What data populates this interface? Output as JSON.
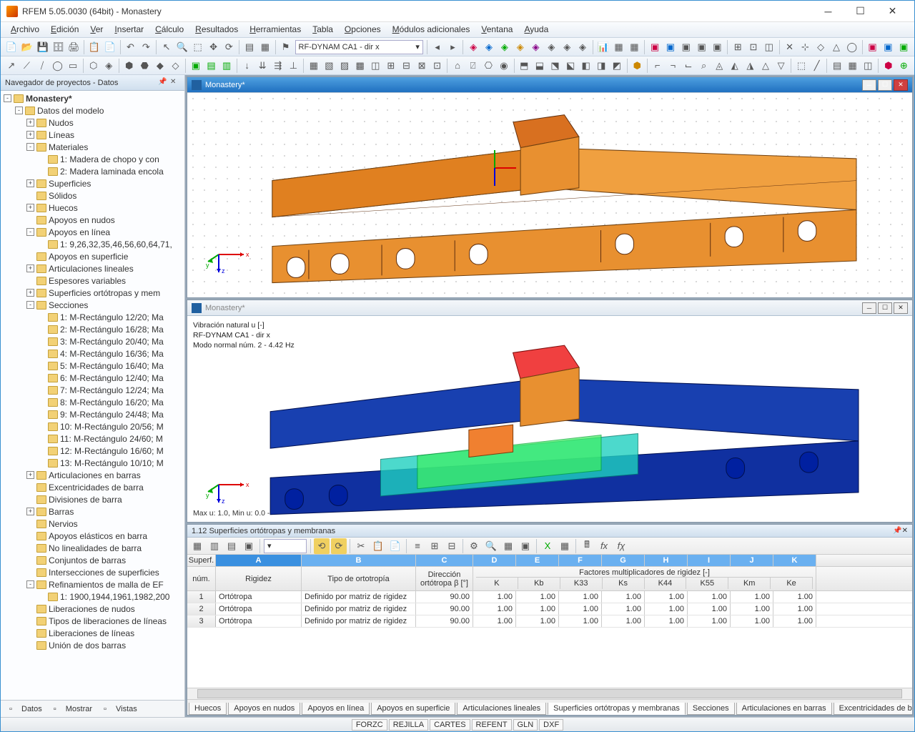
{
  "title": "RFEM 5.05.0030 (64bit) - Monastery",
  "menu": [
    "Archivo",
    "Edición",
    "Ver",
    "Insertar",
    "Cálculo",
    "Resultados",
    "Herramientas",
    "Tabla",
    "Opciones",
    "Módulos adicionales",
    "Ventana",
    "Ayuda"
  ],
  "combo": "RF-DYNAM CA1 - dir x",
  "nav_title": "Navegador de proyectos - Datos",
  "tree": {
    "root": "Monastery*",
    "folder": "Datos del modelo",
    "items": [
      {
        "t": "Nudos",
        "e": "+",
        "i": 1
      },
      {
        "t": "Líneas",
        "e": "+",
        "i": 1
      },
      {
        "t": "Materiales",
        "e": "-",
        "i": 1,
        "c": [
          {
            "t": "1: Madera de chopo y con",
            "i": 2
          },
          {
            "t": "2: Madera laminada encola",
            "i": 2
          }
        ]
      },
      {
        "t": "Superficies",
        "e": "+",
        "i": 1
      },
      {
        "t": "Sólidos",
        "e": "",
        "i": 1
      },
      {
        "t": "Huecos",
        "e": "+",
        "i": 1
      },
      {
        "t": "Apoyos en nudos",
        "e": "",
        "i": 1
      },
      {
        "t": "Apoyos en línea",
        "e": "-",
        "i": 1,
        "c": [
          {
            "t": "1: 9,26,32,35,46,56,60,64,71,",
            "i": 2
          }
        ]
      },
      {
        "t": "Apoyos en superficie",
        "e": "",
        "i": 1
      },
      {
        "t": "Articulaciones lineales",
        "e": "+",
        "i": 1
      },
      {
        "t": "Espesores variables",
        "e": "",
        "i": 1
      },
      {
        "t": "Superficies ortótropas y mem",
        "e": "+",
        "i": 1
      },
      {
        "t": "Secciones",
        "e": "-",
        "i": 1,
        "c": [
          {
            "t": "1: M-Rectángulo 12/20; Ma",
            "i": 2
          },
          {
            "t": "2: M-Rectángulo 16/28; Ma",
            "i": 2
          },
          {
            "t": "3: M-Rectángulo 20/40; Ma",
            "i": 2
          },
          {
            "t": "4: M-Rectángulo 16/36; Ma",
            "i": 2
          },
          {
            "t": "5: M-Rectángulo 16/40; Ma",
            "i": 2
          },
          {
            "t": "6: M-Rectángulo 12/40; Ma",
            "i": 2
          },
          {
            "t": "7: M-Rectángulo 12/24; Ma",
            "i": 2
          },
          {
            "t": "8: M-Rectángulo 16/20; Ma",
            "i": 2
          },
          {
            "t": "9: M-Rectángulo 24/48; Ma",
            "i": 2
          },
          {
            "t": "10: M-Rectángulo 20/56; M",
            "i": 2
          },
          {
            "t": "11: M-Rectángulo 24/60; M",
            "i": 2
          },
          {
            "t": "12: M-Rectángulo 16/60; M",
            "i": 2
          },
          {
            "t": "13: M-Rectángulo 10/10; M",
            "i": 2
          }
        ]
      },
      {
        "t": "Articulaciones en barras",
        "e": "+",
        "i": 1
      },
      {
        "t": "Excentricidades de barra",
        "e": "",
        "i": 1
      },
      {
        "t": "Divisiones de barra",
        "e": "",
        "i": 1
      },
      {
        "t": "Barras",
        "e": "+",
        "i": 1
      },
      {
        "t": "Nervios",
        "e": "",
        "i": 1
      },
      {
        "t": "Apoyos elásticos en barra",
        "e": "",
        "i": 1
      },
      {
        "t": "No linealidades de barra",
        "e": "",
        "i": 1
      },
      {
        "t": "Conjuntos de barras",
        "e": "",
        "i": 1
      },
      {
        "t": "Intersecciones de superficies",
        "e": "",
        "i": 1
      },
      {
        "t": "Refinamientos de malla de EF",
        "e": "-",
        "i": 1,
        "c": [
          {
            "t": "1: 1900,1944,1961,1982,200",
            "i": 2
          }
        ]
      },
      {
        "t": "Liberaciones de nudos",
        "e": "",
        "i": 1
      },
      {
        "t": "Tipos de liberaciones de líneas",
        "e": "",
        "i": 1
      },
      {
        "t": "Liberaciones de líneas",
        "e": "",
        "i": 1
      },
      {
        "t": "Unión de dos barras",
        "e": "",
        "i": 1
      }
    ]
  },
  "nav_tabs": [
    "Datos",
    "Mostrar",
    "Vistas"
  ],
  "mdi_top_title": "Monastery*",
  "mdi_bot_title": "Monastery*",
  "vib_lines": [
    "Vibración natural  u [-]",
    "RF-DYNAM CA1 - dir x",
    "Modo normal núm. 2 - 4.42 Hz"
  ],
  "vib_bottom": "Max u: 1.0, Min u: 0.0 -",
  "data_title": "1.12 Superficies ortótropas y membranas",
  "grid_group_label": "Factores multiplicadores de rigidez [-]",
  "grid": {
    "row_hdr": [
      "Superf.",
      "núm."
    ],
    "cols": [
      "A",
      "B",
      "C",
      "D",
      "E",
      "F",
      "G",
      "H",
      "I",
      "J",
      "K"
    ],
    "sub": [
      "Rigidez",
      "Tipo de ortotropía",
      "Dirección ortótropa β [°]",
      "K",
      "Kb",
      "K33",
      "Ks",
      "K44",
      "K55",
      "Km",
      "Ke"
    ],
    "rows": [
      [
        "1",
        "Ortótropa",
        "Definido por matriz de rigidez",
        "90.00",
        "1.00",
        "1.00",
        "1.00",
        "1.00",
        "1.00",
        "1.00",
        "1.00",
        "1.00"
      ],
      [
        "2",
        "Ortótropa",
        "Definido por matriz de rigidez",
        "90.00",
        "1.00",
        "1.00",
        "1.00",
        "1.00",
        "1.00",
        "1.00",
        "1.00",
        "1.00"
      ],
      [
        "3",
        "Ortótropa",
        "Definido por matriz de rigidez",
        "90.00",
        "1.00",
        "1.00",
        "1.00",
        "1.00",
        "1.00",
        "1.00",
        "1.00",
        "1.00"
      ]
    ]
  },
  "bottom_tabs": [
    "Huecos",
    "Apoyos en nudos",
    "Apoyos en línea",
    "Apoyos en superficie",
    "Articulaciones lineales",
    "Superficies ortótropas y membranas",
    "Secciones",
    "Articulaciones en barras",
    "Excentricidades de barras"
  ],
  "bottom_tabs_active": 5,
  "status": [
    "FORZC",
    "REJILLA",
    "CARTES",
    "REFENT",
    "GLN",
    "DXF"
  ]
}
